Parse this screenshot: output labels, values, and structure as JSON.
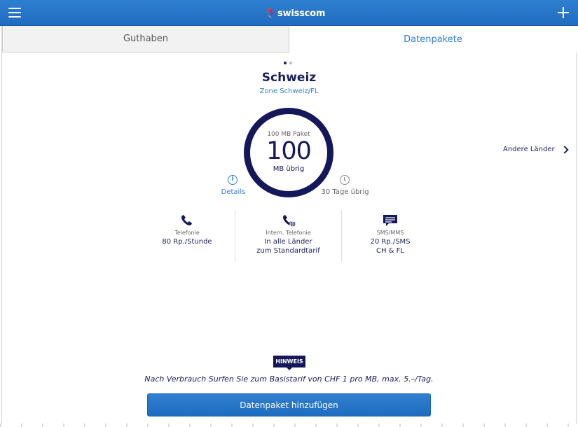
{
  "header": {
    "brand": "swisscom"
  },
  "tabs": [
    {
      "label": "Guthaben",
      "active": false
    },
    {
      "label": "Datenpakete",
      "active": true
    }
  ],
  "pager": {
    "current": 1,
    "total": 2
  },
  "plan": {
    "country": "Schweiz",
    "zone": "Zone Schweiz/FL",
    "package_label": "100 MB Paket",
    "remaining": "100",
    "remaining_unit": "MB übrig",
    "details_label": "Details",
    "days_remaining": "30 Tage übrig"
  },
  "other_countries": "Andere Länder",
  "features": [
    {
      "icon": "phone-icon",
      "title": "Telefonie",
      "value_line1": "80 Rp./Stunde",
      "value_line2": ""
    },
    {
      "icon": "international-phone-icon",
      "title": "Intern. Telefonie",
      "value_line1": "In alle Länder",
      "value_line2": "zum Standardtarif"
    },
    {
      "icon": "sms-icon",
      "title": "SMS/MMS",
      "value_line1": "20 Rp./SMS",
      "value_line2": "CH & FL"
    }
  ],
  "notice": {
    "badge": "HINWEIS",
    "text": "Nach Verbrauch Surfen Sie zum Basistarif von CHF 1 pro MB, max. 5.–/Tag."
  },
  "add_button": "Datenpaket hinzufügen",
  "colors": {
    "brand_blue": "#2f7fd0",
    "navy": "#14175a"
  }
}
